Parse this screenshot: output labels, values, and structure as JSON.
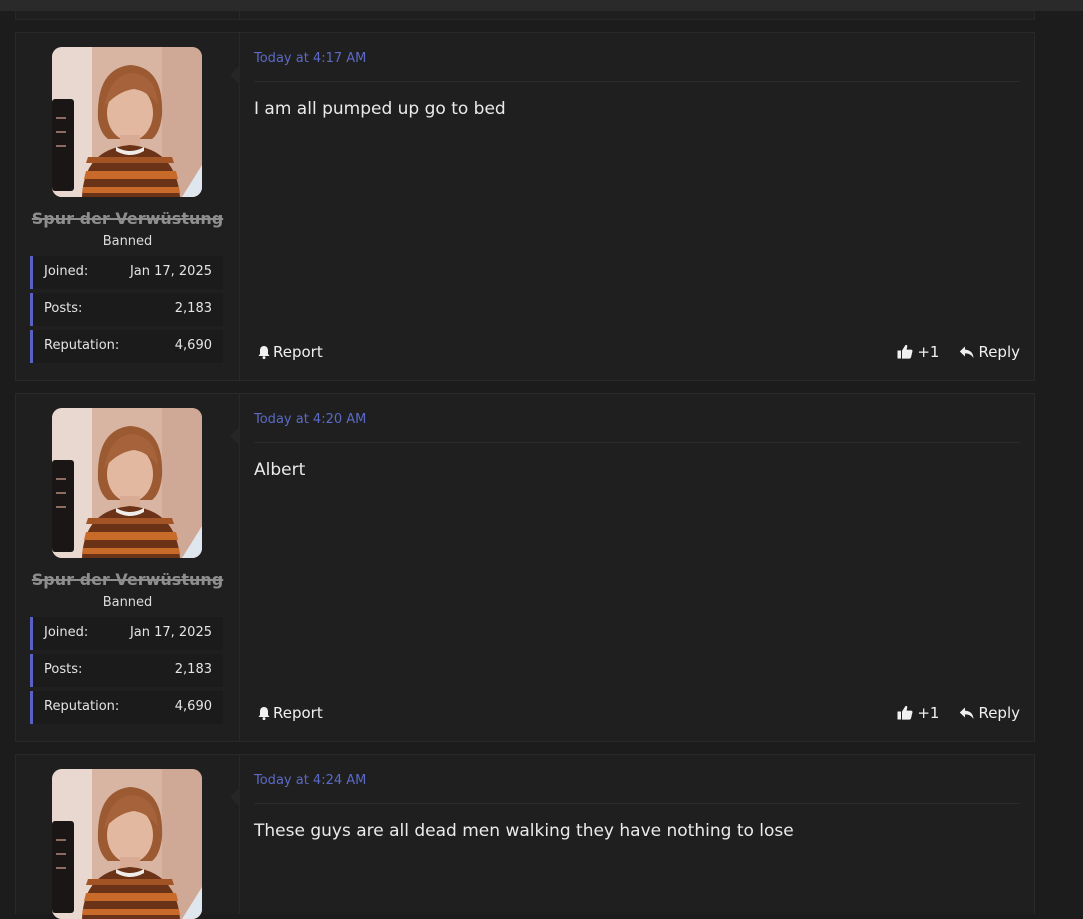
{
  "posts": [
    {
      "username": "Spur der Verwüstung",
      "user_title": "Banned",
      "stats": [
        {
          "label": "Joined:",
          "value": "Jan 17, 2025"
        },
        {
          "label": "Posts:",
          "value": "2,183"
        },
        {
          "label": "Reputation:",
          "value": "4,690"
        }
      ],
      "timestamp": "Today at 4:17 AM",
      "message": "I am all pumped up go to bed",
      "report_label": "Report",
      "like_label": "+1",
      "reply_label": "Reply"
    },
    {
      "username": "Spur der Verwüstung",
      "user_title": "Banned",
      "stats": [
        {
          "label": "Joined:",
          "value": "Jan 17, 2025"
        },
        {
          "label": "Posts:",
          "value": "2,183"
        },
        {
          "label": "Reputation:",
          "value": "4,690"
        }
      ],
      "timestamp": "Today at 4:20 AM",
      "message": "Albert",
      "report_label": "Report",
      "like_label": "+1",
      "reply_label": "Reply"
    },
    {
      "timestamp": "Today at 4:24 AM",
      "message": "These guys are all dead men walking they have nothing to lose"
    }
  ],
  "colors": {
    "accent": "#5b61c2",
    "timestamp": "#5b6ac4",
    "background": "#1c1c1c",
    "panel": "#1f1f1f"
  },
  "icons": {
    "report": "bell-icon",
    "like": "thumbs-up-icon",
    "reply": "reply-arrow-icon"
  }
}
